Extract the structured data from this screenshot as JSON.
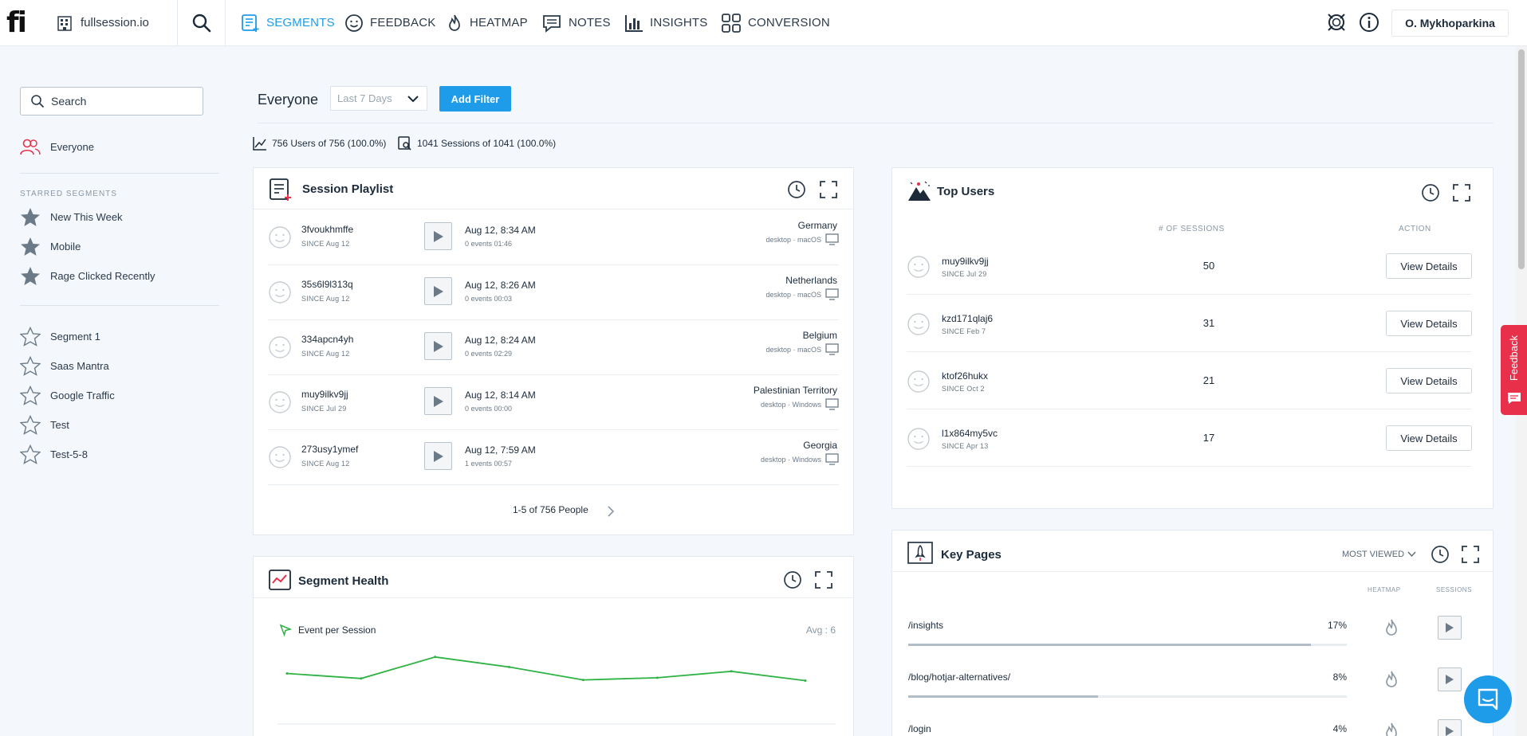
{
  "app": {
    "logo": "fi",
    "org": "fullsession.io",
    "user": "O. Mykhoparkina"
  },
  "nav": [
    {
      "label": "SEGMENTS",
      "icon": "segments-icon",
      "active": true
    },
    {
      "label": "FEEDBACK",
      "icon": "smiley-icon",
      "active": false
    },
    {
      "label": "HEATMAP",
      "icon": "flame-icon",
      "active": false
    },
    {
      "label": "NOTES",
      "icon": "notes-icon",
      "active": false
    },
    {
      "label": "INSIGHTS",
      "icon": "bar-chart-icon",
      "active": false
    },
    {
      "label": "CONVERSION",
      "icon": "conversion-icon",
      "active": false
    }
  ],
  "sidebar": {
    "search_placeholder": "Search",
    "everyone": "Everyone",
    "starred_title": "STARRED SEGMENTS",
    "starred": [
      "New This Week",
      "Mobile",
      "Rage Clicked Recently"
    ],
    "segments": [
      "Segment 1",
      "Saas Mantra",
      "Google Traffic",
      "Test",
      "Test-5-8"
    ]
  },
  "header": {
    "segment": "Everyone",
    "date_range": "Last 7 Days",
    "add_filter": "Add Filter",
    "users_stat": "756 Users of 756 (100.0%)",
    "sessions_stat": "1041 Sessions of 1041 (100.0%)"
  },
  "playlist": {
    "title": "Session Playlist",
    "rows": [
      {
        "user": "3fvoukhmffe",
        "since": "SINCE Aug 12",
        "time": "Aug 12, 8:34 AM",
        "events": "0 events  01:46",
        "country": "Germany",
        "device": "desktop · macOS"
      },
      {
        "user": "35s6l9l313q",
        "since": "SINCE Aug 12",
        "time": "Aug 12, 8:26 AM",
        "events": "0 events  00:03",
        "country": "Netherlands",
        "device": "desktop · macOS"
      },
      {
        "user": "334apcn4yh",
        "since": "SINCE Aug 12",
        "time": "Aug 12, 8:24 AM",
        "events": "0 events  02:29",
        "country": "Belgium",
        "device": "desktop · macOS"
      },
      {
        "user": "muy9ilkv9jj",
        "since": "SINCE Jul 29",
        "time": "Aug 12, 8:14 AM",
        "events": "0 events  00:00",
        "country": "Palestinian Territory",
        "device": "desktop · Windows"
      },
      {
        "user": "273usy1ymef",
        "since": "SINCE Aug 12",
        "time": "Aug 12, 7:59 AM",
        "events": "1 events  00:57",
        "country": "Georgia",
        "device": "desktop · Windows"
      }
    ],
    "pagination": "1-5 of 756 People"
  },
  "top_users": {
    "title": "Top Users",
    "col_sessions": "# OF SESSIONS",
    "col_action": "ACTION",
    "action_label": "View Details",
    "rows": [
      {
        "user": "muy9ilkv9jj",
        "since": "SINCE Jul 29",
        "sessions": "50"
      },
      {
        "user": "kzd171qlaj6",
        "since": "SINCE Feb 7",
        "sessions": "31"
      },
      {
        "user": "ktof26hukx",
        "since": "SINCE Oct 2",
        "sessions": "21"
      },
      {
        "user": "l1x864my5vc",
        "since": "SINCE Apr 13",
        "sessions": "17"
      }
    ]
  },
  "health": {
    "title": "Segment Health",
    "metric": "Event per Session",
    "avg": "Avg : 6",
    "series": [
      6.5,
      5.8,
      8.8,
      7.4,
      5.6,
      5.9,
      6.8,
      5.5
    ],
    "line_color": "#2fb344"
  },
  "key_pages": {
    "title": "Key Pages",
    "sort": "MOST VIEWED",
    "col_heatmap": "HEATMAP",
    "col_sessions": "SESSIONS",
    "rows": [
      {
        "path": "/insights",
        "pct": "17%",
        "share": 0.17
      },
      {
        "path": "/blog/hotjar-alternatives/",
        "pct": "8%",
        "share": 0.08
      },
      {
        "path": "/login",
        "pct": "4%",
        "share": 0.04
      }
    ]
  },
  "feedback_tab": "Feedback",
  "colors": {
    "accent": "#1e9be9",
    "feedback": "#e8304a"
  }
}
